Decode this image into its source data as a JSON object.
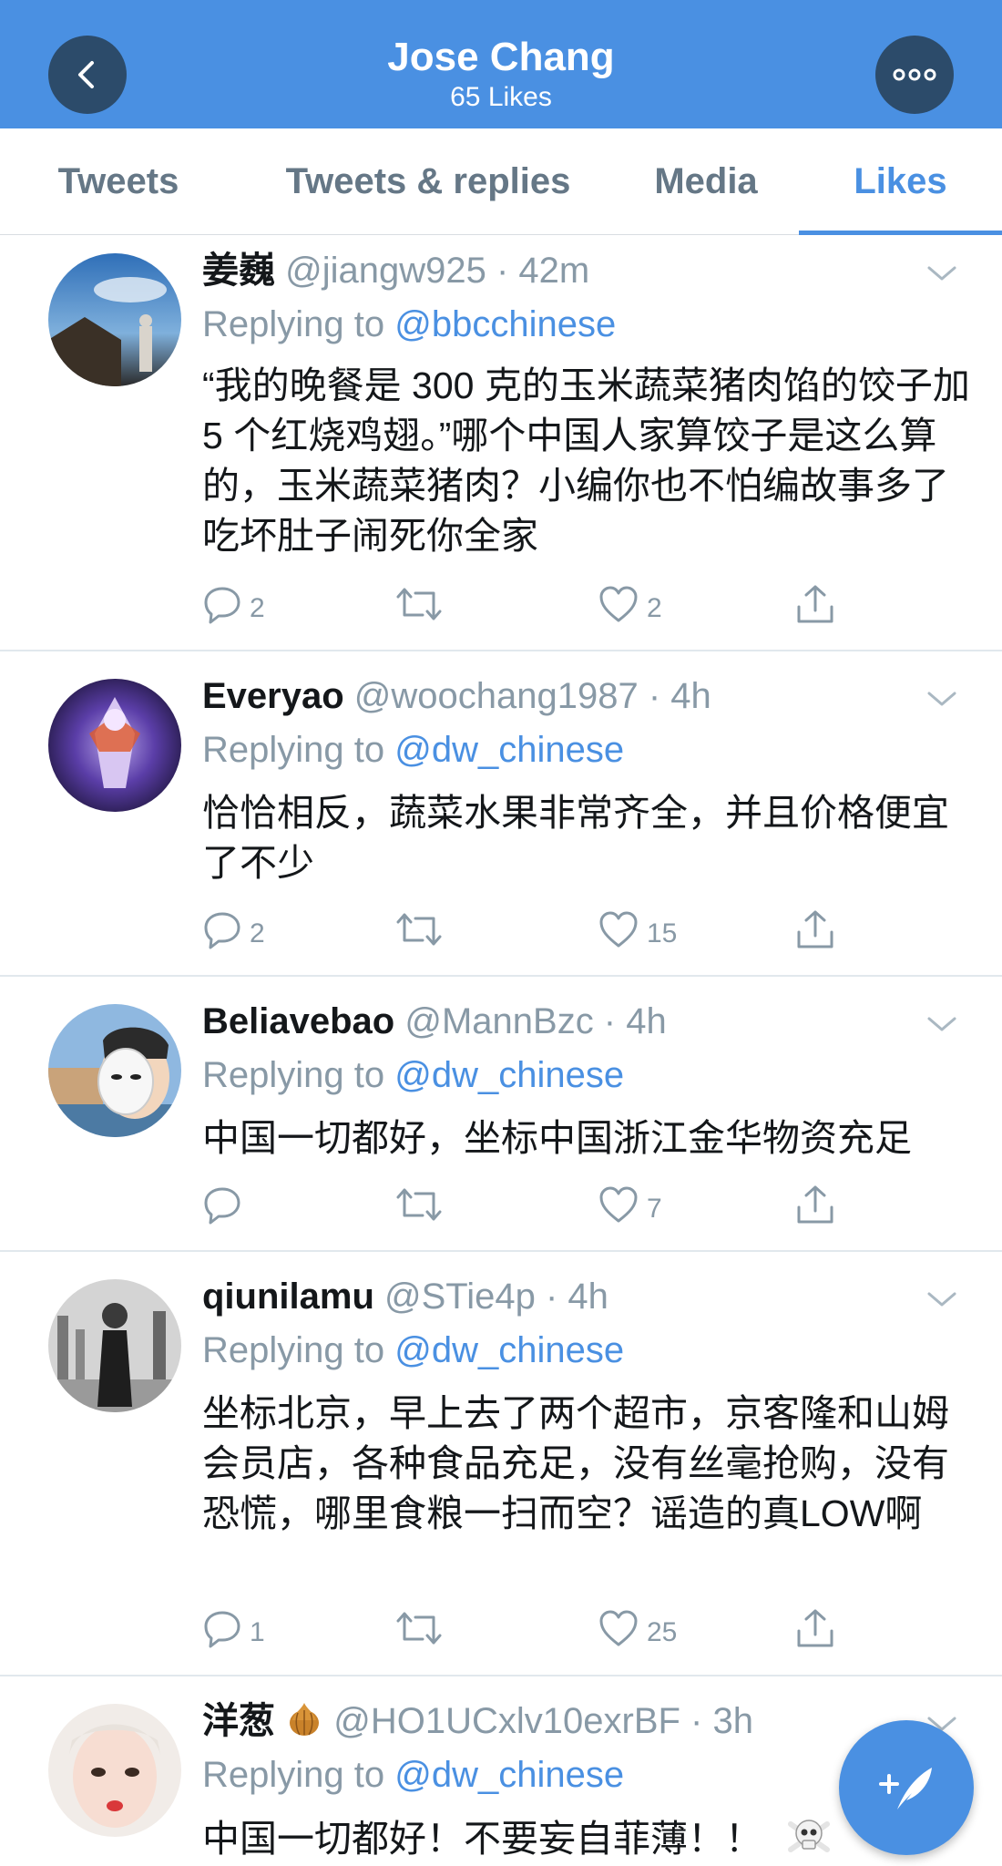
{
  "header": {
    "title": "Jose Chang",
    "subtitle": "65 Likes"
  },
  "tabs": [
    {
      "label": "Tweets"
    },
    {
      "label": "Tweets & replies"
    },
    {
      "label": "Media"
    },
    {
      "label": "Likes",
      "active": true
    }
  ],
  "tweets": [
    {
      "name": "姜巍",
      "handle": "@jiangw925",
      "time": "42m",
      "replying_prefix": "Replying to",
      "replying_to": "@bbcchinese",
      "text": "“我的晚餐是 300 克的玉米蔬菜猪肉馅的饺子加 5 个红烧鸡翅。”哪个中国人家算饺子是这么算的，玉米蔬菜猪肉？小编你也不怕编故事多了吃坏肚子闹死你全家",
      "replies": "2",
      "retweets": "",
      "likes": "2"
    },
    {
      "name": "Everyao",
      "handle": "@woochang1987",
      "time": "4h",
      "replying_prefix": "Replying to",
      "replying_to": "@dw_chinese",
      "text": "恰恰相反，蔬菜水果非常齐全，并且价格便宜了不少",
      "replies": "2",
      "retweets": "",
      "likes": "15"
    },
    {
      "name": "Beliavebao",
      "handle": "@MannBzc",
      "time": "4h",
      "replying_prefix": "Replying to",
      "replying_to": "@dw_chinese",
      "text": "中国一切都好，坐标中国浙江金华物资充足",
      "replies": "",
      "retweets": "",
      "likes": "7"
    },
    {
      "name": "qiunilamu",
      "handle": "@STie4p",
      "time": "4h",
      "replying_prefix": "Replying to",
      "replying_to": "@dw_chinese",
      "text": "坐标北京，早上去了两个超市，京客隆和山姆会员店，各种食品充足，没有丝毫抢购，没有恐慌，哪里食粮一扫而空？谣造的真LOW啊",
      "replies": "1",
      "retweets": "",
      "likes": "25"
    },
    {
      "name": "洋葱",
      "handle": "@HO1UCxlv10exrBF",
      "time": "3h",
      "replying_prefix": "Replying to",
      "replying_to": "@dw_chinese",
      "text": "中国一切都好！不要妄自菲薄！！"
    }
  ],
  "icons": {
    "back": "chevron-left-icon",
    "more": "ellipsis-icon",
    "compose": "compose-feather-icon",
    "reply": "reply-icon",
    "retweet": "retweet-icon",
    "like": "heart-icon",
    "share": "share-icon",
    "onion": "onion-emoji",
    "skull": "skull-crossbones-emoji"
  },
  "colors": {
    "brand": "#4a90e2",
    "header_button": "#2c4b6a",
    "muted_text": "#8899a6",
    "divider": "#e1e8ed"
  }
}
